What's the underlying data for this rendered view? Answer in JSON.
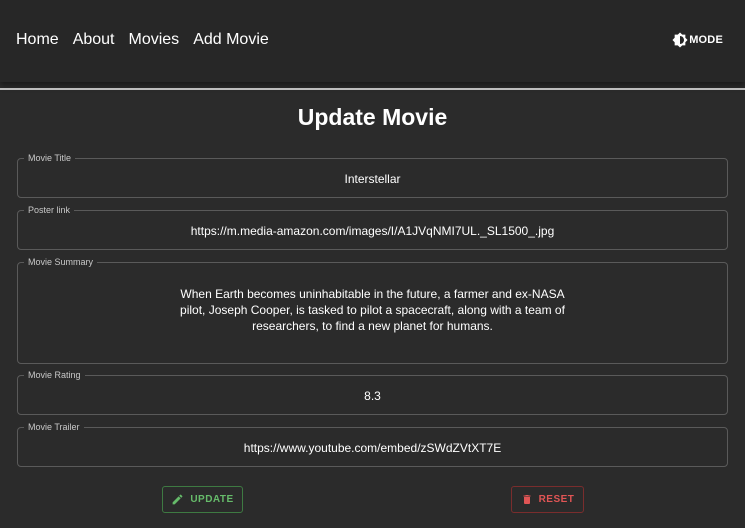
{
  "nav": {
    "links": [
      "Home",
      "About",
      "Movies",
      "Add Movie"
    ],
    "mode_label": "MODE",
    "mode_icon": "contrast-icon"
  },
  "page": {
    "title": "Update Movie"
  },
  "form": {
    "title_label": "Movie Title",
    "title_value": "Interstellar",
    "poster_label": "Poster link",
    "poster_value": "https://m.media-amazon.com/images/I/A1JVqNMI7UL._SL1500_.jpg",
    "summary_label": "Movie Summary",
    "summary_value": "When Earth becomes uninhabitable in the future, a farmer and ex-NASA pilot, Joseph Cooper, is tasked to pilot a spacecraft, along with a team of researchers, to find a new planet for humans.",
    "rating_label": "Movie Rating",
    "rating_value": "8.3",
    "trailer_label": "Movie Trailer",
    "trailer_value": "https://www.youtube.com/embed/zSWdZVtXT7E"
  },
  "actions": {
    "update_label": "UPDATE",
    "update_icon": "pencil-icon",
    "reset_label": "RESET",
    "reset_icon": "trash-icon"
  },
  "colors": {
    "background": "#2b2b2b",
    "navbar": "#272727",
    "update_accent": "#66bb6a",
    "reset_accent": "#e05555"
  }
}
